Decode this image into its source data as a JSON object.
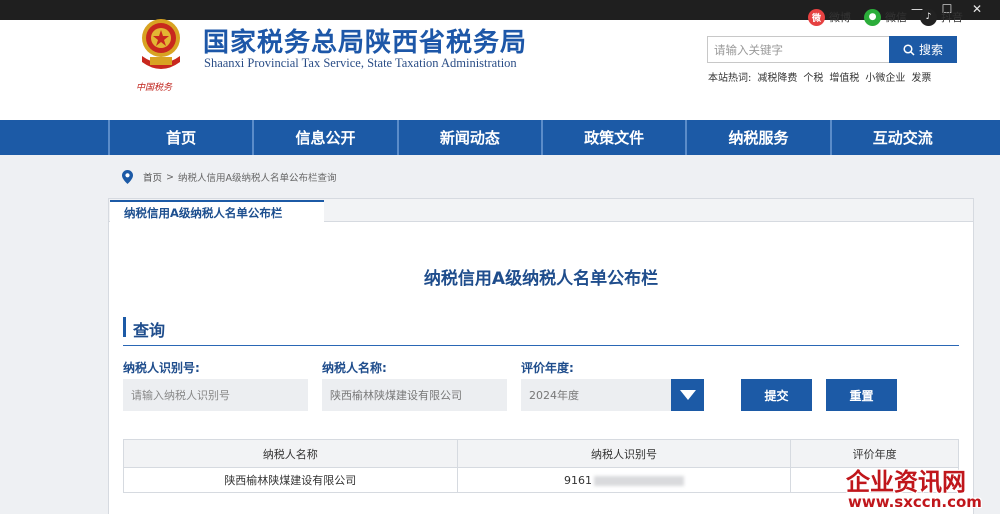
{
  "window": {
    "minimize": "—",
    "maximize": "☐",
    "close": "✕"
  },
  "header": {
    "title": "国家税务总局陕西省税务局",
    "subtitle": "Shaanxi Provincial Tax Service, State Taxation Administration",
    "emblem_caption": "中国税务",
    "social": [
      {
        "label": "微博",
        "icon": "weibo-icon"
      },
      {
        "label": "微信",
        "icon": "wechat-icon"
      },
      {
        "label": "抖音",
        "icon": "douyin-icon"
      }
    ],
    "search": {
      "placeholder": "请输入关键字",
      "button_label": "搜索"
    },
    "hotwords": {
      "label": "本站热词:",
      "items": [
        "减税降费",
        "个税",
        "增值税",
        "小微企业",
        "发票"
      ]
    }
  },
  "nav": {
    "items": [
      "首页",
      "信息公开",
      "新闻动态",
      "政策文件",
      "纳税服务",
      "互动交流"
    ]
  },
  "breadcrumb": {
    "home": "首页",
    "separator": ">",
    "current": "纳税人信用A级纳税人名单公布栏查询"
  },
  "panel": {
    "tab_label": "纳税信用A级纳税人名单公布栏",
    "title": "纳税信用A级纳税人名单公布栏",
    "section_title": "查询"
  },
  "form": {
    "id_label": "纳税人识别号:",
    "id_placeholder": "请输入纳税人识别号",
    "name_label": "纳税人名称:",
    "name_value": "陕西榆林陕煤建设有限公司",
    "year_label": "评价年度:",
    "year_value": "2024年度",
    "submit_label": "提交",
    "reset_label": "重置"
  },
  "table": {
    "headers": [
      "纳税人名称",
      "纳税人识别号",
      "评价年度"
    ],
    "rows": [
      {
        "name": "陕西榆林陕煤建设有限公司",
        "id_visible": "9161",
        "year": ""
      }
    ]
  },
  "watermark": {
    "line1": "企业资讯网",
    "line2": "www.sxccn.com"
  },
  "colors": {
    "brand_blue": "#1c5aa6",
    "title_blue": "#1d57a8",
    "watermark_red": "#c0161b"
  }
}
